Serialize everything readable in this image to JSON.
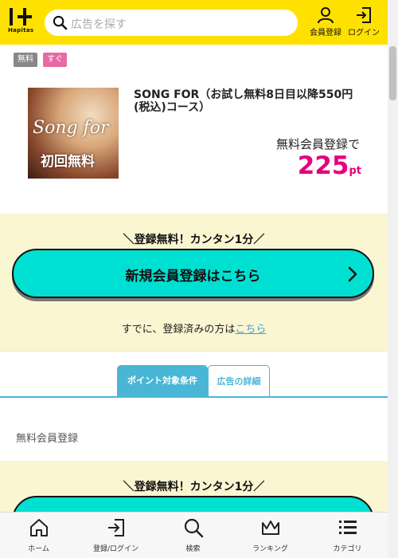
{
  "header": {
    "logo_text": "Hapitas",
    "search_placeholder": "広告を探す",
    "register_label": "会員登録",
    "login_label": "ログイン"
  },
  "tags": [
    "無料",
    "すぐ"
  ],
  "product": {
    "title": "SONG FOR（お試し無料8日目以降550円(税込)コース）",
    "image_text_1": "Song for",
    "image_text_2": "初回無料",
    "register_label": "無料会員登録で",
    "points": "225",
    "points_unit": "pt"
  },
  "cta": {
    "headline": "＼登録無料！カンタン1分／",
    "button_label": "新規会員登録はこちら",
    "already_text": "すでに、登録済みの方は",
    "already_link": "こちら"
  },
  "tabs": [
    {
      "label": "ポイント対象条件",
      "active": true
    },
    {
      "label": "広告の詳細",
      "active": false
    }
  ],
  "condition_text": "無料会員登録",
  "bottom_nav": [
    {
      "label": "ホーム",
      "icon": "home-icon"
    },
    {
      "label": "登録/ログイン",
      "icon": "login-icon"
    },
    {
      "label": "検索",
      "icon": "search-icon"
    },
    {
      "label": "ランキング",
      "icon": "crown-icon"
    },
    {
      "label": "カテゴリ",
      "icon": "menu-icon"
    }
  ],
  "colors": {
    "header_bg": "#ffe100",
    "accent_pink": "#e6007e",
    "cta_button": "#00e0d2",
    "cta_band": "#fbf6d2",
    "tab_blue": "#4ab6d6",
    "tag_free": "#888888",
    "tag_soon": "#e86aa5"
  }
}
